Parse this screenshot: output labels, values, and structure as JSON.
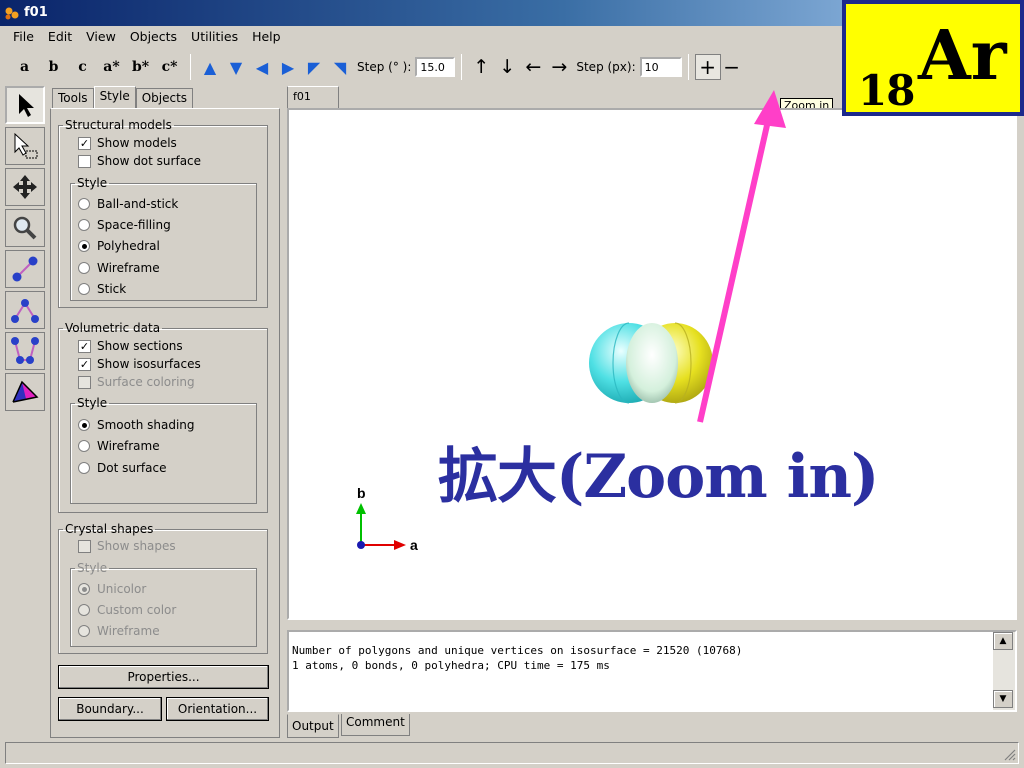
{
  "window": {
    "title": "f01"
  },
  "menu": [
    "File",
    "Edit",
    "View",
    "Objects",
    "Utilities",
    "Help"
  ],
  "toolbar": {
    "axis_buttons": [
      "a",
      "b",
      "c",
      "a*",
      "b*",
      "c*"
    ],
    "step_deg_label": "Step (° ):",
    "step_deg_value": "15.0",
    "step_px_label": "Step (px):",
    "step_px_value": "10",
    "zoom_in": "+",
    "zoom_out": "−",
    "tooltip": "Zoom in"
  },
  "panel": {
    "tabs": [
      "Tools",
      "Style",
      "Objects"
    ],
    "structural": {
      "legend": "Structural models",
      "show_models": "Show models",
      "show_dot_surface": "Show dot surface",
      "style_legend": "Style",
      "styles": [
        "Ball-and-stick",
        "Space-filling",
        "Polyhedral",
        "Wireframe",
        "Stick"
      ]
    },
    "volumetric": {
      "legend": "Volumetric data",
      "show_sections": "Show sections",
      "show_isosurfaces": "Show isosurfaces",
      "surface_coloring": "Surface coloring",
      "style_legend": "Style",
      "styles": [
        "Smooth shading",
        "Wireframe",
        "Dot surface"
      ]
    },
    "crystal": {
      "legend": "Crystal shapes",
      "show_shapes": "Show shapes",
      "style_legend": "Style",
      "styles": [
        "Unicolor",
        "Custom color",
        "Wireframe"
      ]
    },
    "properties_button": "Properties...",
    "boundary_button": "Boundary...",
    "orientation_button": "Orientation..."
  },
  "view": {
    "tab": "f01",
    "axis_b": "b",
    "axis_a": "a"
  },
  "output": {
    "lines": [
      "Number of polygons and unique vertices on isosurface = 21520 (10768)",
      "1 atoms, 0 bonds, 0 polyhedra; CPU time = 175 ms"
    ],
    "tabs": [
      "Output",
      "Comment"
    ]
  },
  "overlay": {
    "element_number": "18",
    "element_symbol": "Ar",
    "annotation": "拡大(Zoom in)",
    "arrow_color": "#ff3fc8",
    "annotation_color": "#2b2fa0"
  }
}
